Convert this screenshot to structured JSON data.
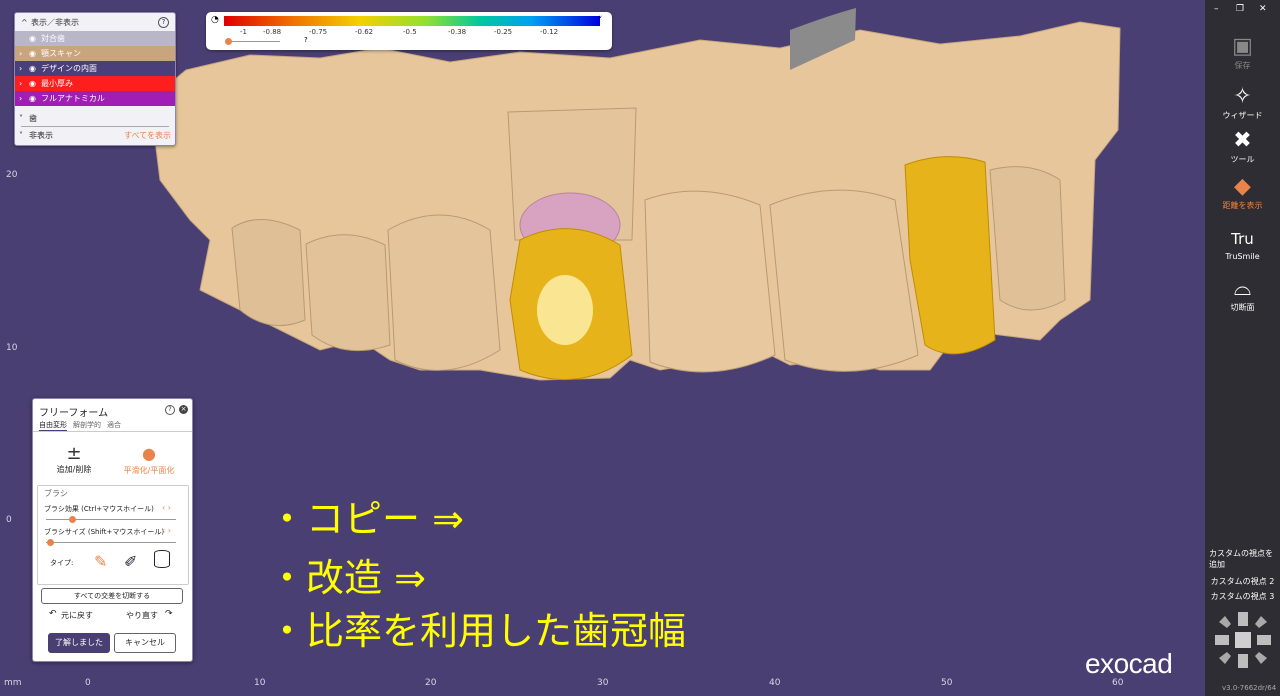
{
  "viewport": {
    "unit": "mm",
    "y_ticks": [
      "20",
      "10",
      "0"
    ],
    "x_ticks": [
      "0",
      "10",
      "20",
      "30",
      "40",
      "50",
      "60"
    ]
  },
  "display_panel": {
    "title": "表示／非表示",
    "help_icon": "question-circle-icon",
    "rows": [
      {
        "label": "対合歯",
        "color": "#b9b6c8",
        "text_color": "#ffffff"
      },
      {
        "label": "顎スキャン",
        "color": "#c9a57d",
        "text_color": "#ffffff"
      },
      {
        "label": "デザインの内面",
        "color": "#4b3f7a",
        "text_color": "#ffffff"
      },
      {
        "label": "最小厚み",
        "color": "#ff1e1e",
        "text_color": "#ffffff"
      },
      {
        "label": "フルアナトミカル",
        "color": "#a11eb4",
        "text_color": "#ffffff"
      }
    ],
    "sections": {
      "teeth": "歯",
      "hidden": "非表示",
      "show_all": "すべてを表示"
    }
  },
  "colorbar": {
    "ticks": [
      "-1",
      "-0.88",
      "-0.75",
      "-0.62",
      "-0.5",
      "-0.38",
      "-0.25",
      "-0.12"
    ],
    "slider_label": "?",
    "gauge_icon": "gauge-icon",
    "chevron_icon": "chevron-down-icon"
  },
  "freeform_panel": {
    "title": "フリーフォーム",
    "tabs": [
      "自由変形",
      "解剖学的",
      "適合"
    ],
    "tools": [
      {
        "glyph": "±",
        "label": "追加/削除",
        "color": "#333333"
      },
      {
        "glyph": "💧",
        "label": "平滑化/平面化",
        "color": "#e8844a"
      }
    ],
    "brush_group": "ブラシ",
    "brush_effect_label": "ブラシ効果 (Ctrl+マウスホイール)",
    "brush_effect_level": 0.2,
    "brush_size_label": "ブラシサイズ (Shift+マウスホイール)",
    "brush_size_level": 0.03,
    "type_label": "タイプ:",
    "cut_all_button": "すべての交差を切断する",
    "undo_button": "元に戻す",
    "redo_button": "やり直す",
    "ok_button": "了解しました",
    "cancel_button": "キャンセル"
  },
  "overlay_text": [
    "・コピー ⇒",
    "・改造 ⇒",
    "・比率を利用した歯冠幅"
  ],
  "toolbar": {
    "items": [
      {
        "label": "保存",
        "icon": "save-icon",
        "enabled": false
      },
      {
        "label": "ウィザード",
        "icon": "wizard-wand-icon",
        "enabled": true
      },
      {
        "label": "ツール",
        "icon": "tools-icon",
        "enabled": true
      },
      {
        "label": "距離を表示",
        "icon": "distance-icon",
        "enabled": true,
        "active": true
      },
      {
        "label": "TruSmile",
        "icon": "trusmile-icon",
        "enabled": true
      },
      {
        "label": "切断面",
        "icon": "cut-plane-icon",
        "enabled": true
      }
    ],
    "custom_views": {
      "add": "カスタムの視点を追加",
      "view2": "カスタムの視点 2",
      "view3": "カスタムの視点 3"
    },
    "window_controls": [
      "minimize-icon",
      "restore-icon",
      "close-icon"
    ]
  },
  "branding": {
    "logo": "exocad",
    "version": "v3.0-7662dr/64"
  }
}
